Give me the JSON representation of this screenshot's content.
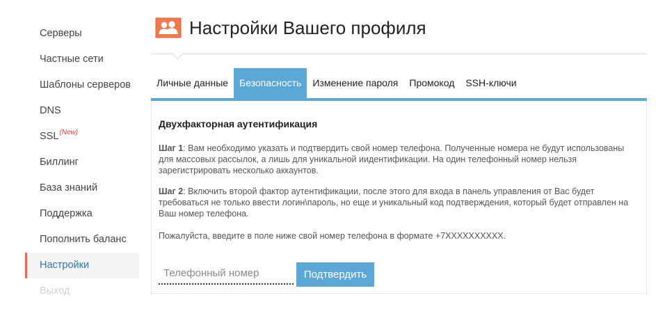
{
  "sidebar": {
    "items": [
      {
        "label": "Серверы"
      },
      {
        "label": "Частные сети"
      },
      {
        "label": "Шаблоны серверов"
      },
      {
        "label": "DNS"
      },
      {
        "label": "SSL",
        "badge": "(New)"
      },
      {
        "label": "Биллинг"
      },
      {
        "label": "База знаний"
      },
      {
        "label": "Поддержка"
      },
      {
        "label": "Пополнить баланс"
      },
      {
        "label": "Настройки"
      },
      {
        "label": "Выход"
      }
    ]
  },
  "header": {
    "title": "Настройки Вашего профиля",
    "icon": "users-icon"
  },
  "tabs": [
    {
      "label": "Личные данные"
    },
    {
      "label": "Безопасность"
    },
    {
      "label": "Изменение пароля"
    },
    {
      "label": "Промокод"
    },
    {
      "label": "SSH-ключи"
    }
  ],
  "security": {
    "title": "Двухфакторная аутентификация",
    "step1_label": "Шаг 1",
    "step1_text": ": Вам необходимо указать и подтвердить свой номер телефона. Полученные номера не будут использованы для массовых рассылок, а лишь для уникальной иидентификации. На один телефонный номер нельзя зарегистрировать несколько аккаунтов.",
    "step2_label": "Шаг 2",
    "step2_text": ": Включить второй фактор аутентификации, после этого для входа в панель управления от Вас будет требоваться не только ввести логин\\пароль, но еще и уникальный код подтверждения, который будет отправлен на Ваш номер телефона.",
    "instruction": "Пожалуйста, введите в поле ниже свой номер телефона в формате +7XXXXXXXXXX.",
    "phone_placeholder": "Телефонный номер",
    "confirm_label": "Подтвердить"
  },
  "colors": {
    "accent": "#5ba7d6",
    "active_nav_border": "#e86b4d",
    "icon_bg": "#f07a4f",
    "new_badge": "#e23b3b"
  }
}
